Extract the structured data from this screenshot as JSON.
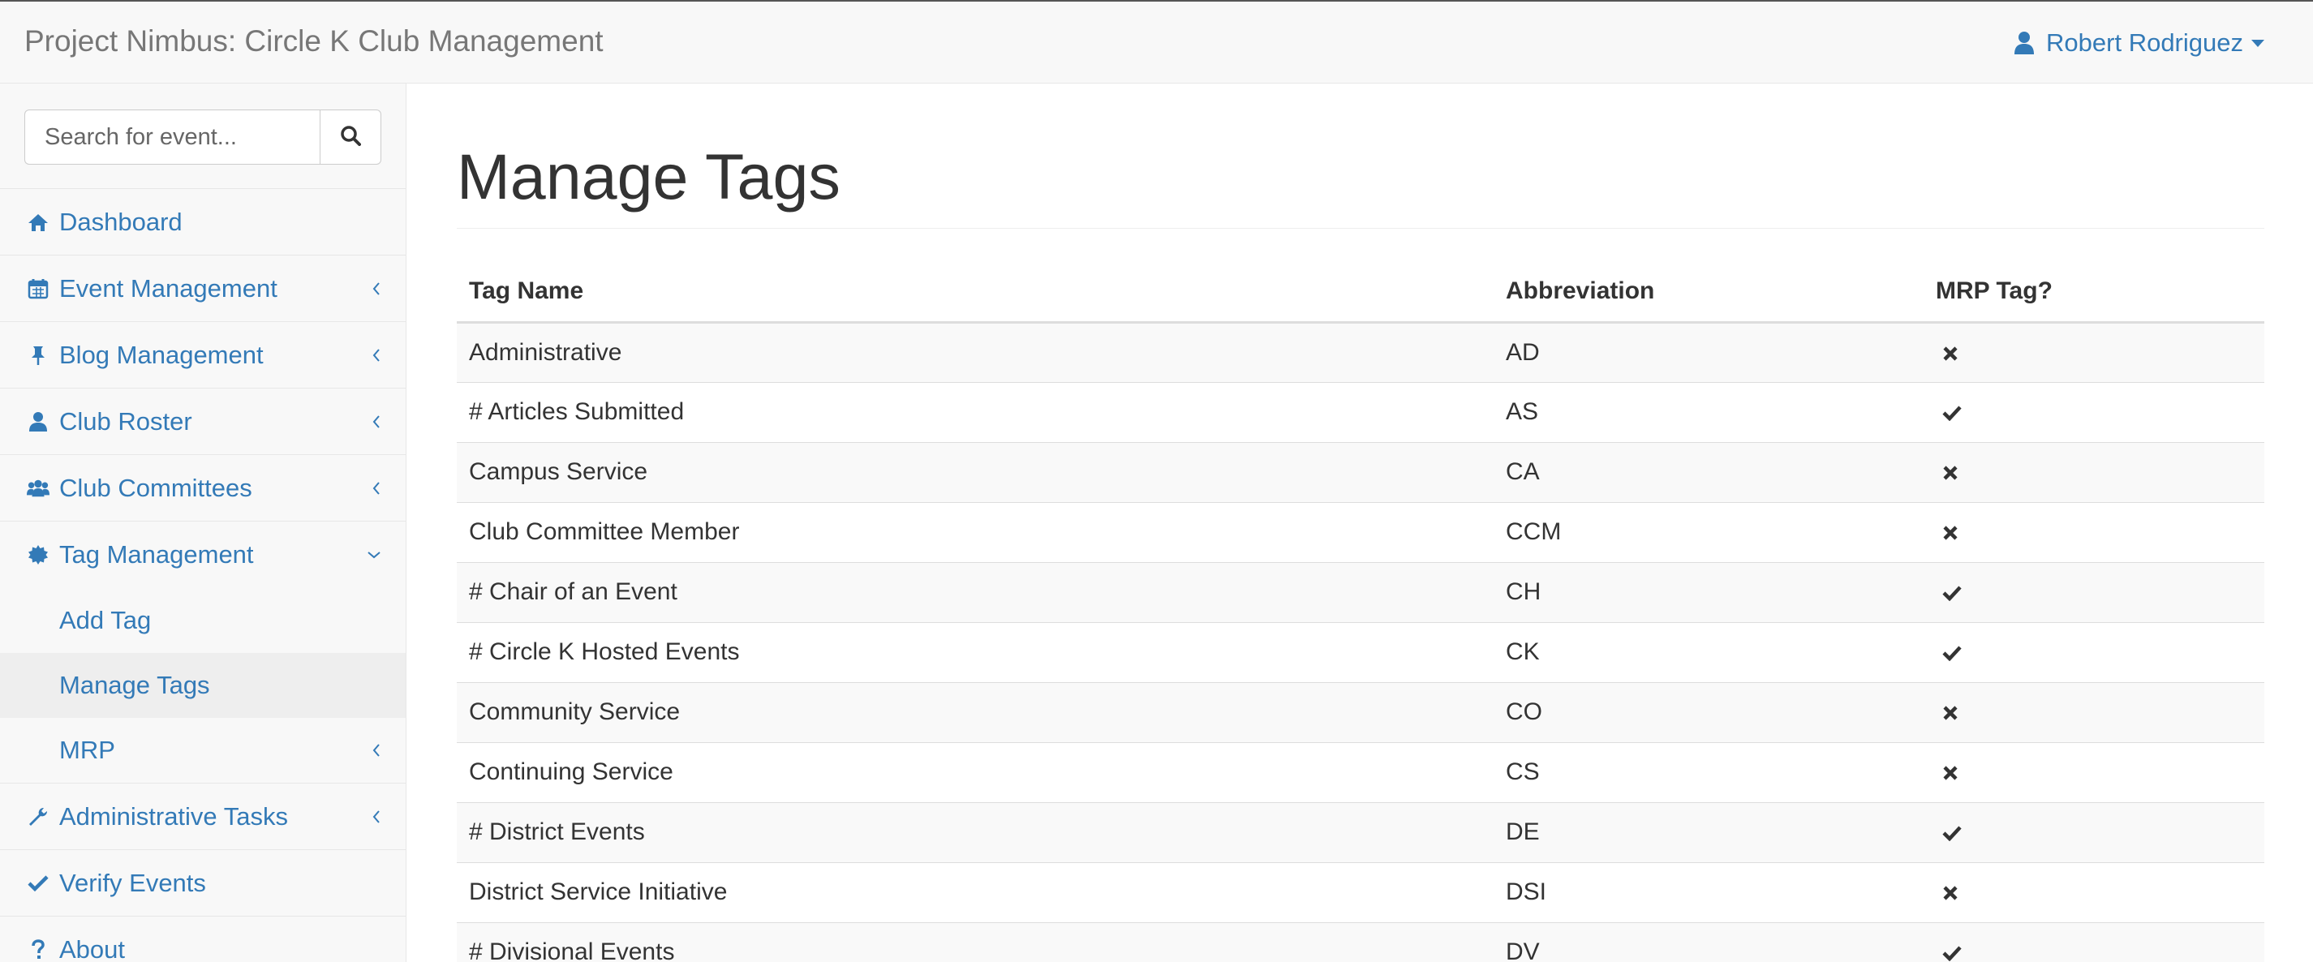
{
  "app": {
    "title": "Project Nimbus: Circle K Club Management",
    "user_name": "Robert Rodriguez"
  },
  "search": {
    "placeholder": "Search for event..."
  },
  "sidebar": {
    "items": [
      {
        "label": "Dashboard",
        "icon": "home-icon"
      },
      {
        "label": "Event Management",
        "icon": "calendar-icon"
      },
      {
        "label": "Blog Management",
        "icon": "pushpin-icon"
      },
      {
        "label": "Club Roster",
        "icon": "user-icon"
      },
      {
        "label": "Club Committees",
        "icon": "users-icon"
      },
      {
        "label": "Tag Management",
        "icon": "certificate-icon"
      },
      {
        "label": "Administrative Tasks",
        "icon": "wrench-icon"
      },
      {
        "label": "Verify Events",
        "icon": "check-icon"
      },
      {
        "label": "About",
        "icon": "question-icon"
      }
    ],
    "tag_submenu": [
      {
        "label": "Add Tag"
      },
      {
        "label": "Manage Tags"
      },
      {
        "label": "MRP"
      }
    ]
  },
  "main": {
    "title": "Manage Tags",
    "columns": [
      "Tag Name",
      "Abbreviation",
      "MRP Tag?"
    ],
    "rows": [
      {
        "name": "Administrative",
        "abbr": "AD",
        "mrp": false
      },
      {
        "name": "# Articles Submitted",
        "abbr": "AS",
        "mrp": true
      },
      {
        "name": "Campus Service",
        "abbr": "CA",
        "mrp": false
      },
      {
        "name": "Club Committee Member",
        "abbr": "CCM",
        "mrp": false
      },
      {
        "name": "# Chair of an Event",
        "abbr": "CH",
        "mrp": true
      },
      {
        "name": "# Circle K Hosted Events",
        "abbr": "CK",
        "mrp": true
      },
      {
        "name": "Community Service",
        "abbr": "CO",
        "mrp": false
      },
      {
        "name": "Continuing Service",
        "abbr": "CS",
        "mrp": false
      },
      {
        "name": "# District Events",
        "abbr": "DE",
        "mrp": true
      },
      {
        "name": "District Service Initiative",
        "abbr": "DSI",
        "mrp": false
      },
      {
        "name": "# Divisional Events",
        "abbr": "DV",
        "mrp": true
      }
    ]
  },
  "colors": {
    "link": "#337ab7",
    "brand_text": "#777777",
    "navbar_bg": "#f8f8f8",
    "active_bg": "#eeeeee"
  }
}
